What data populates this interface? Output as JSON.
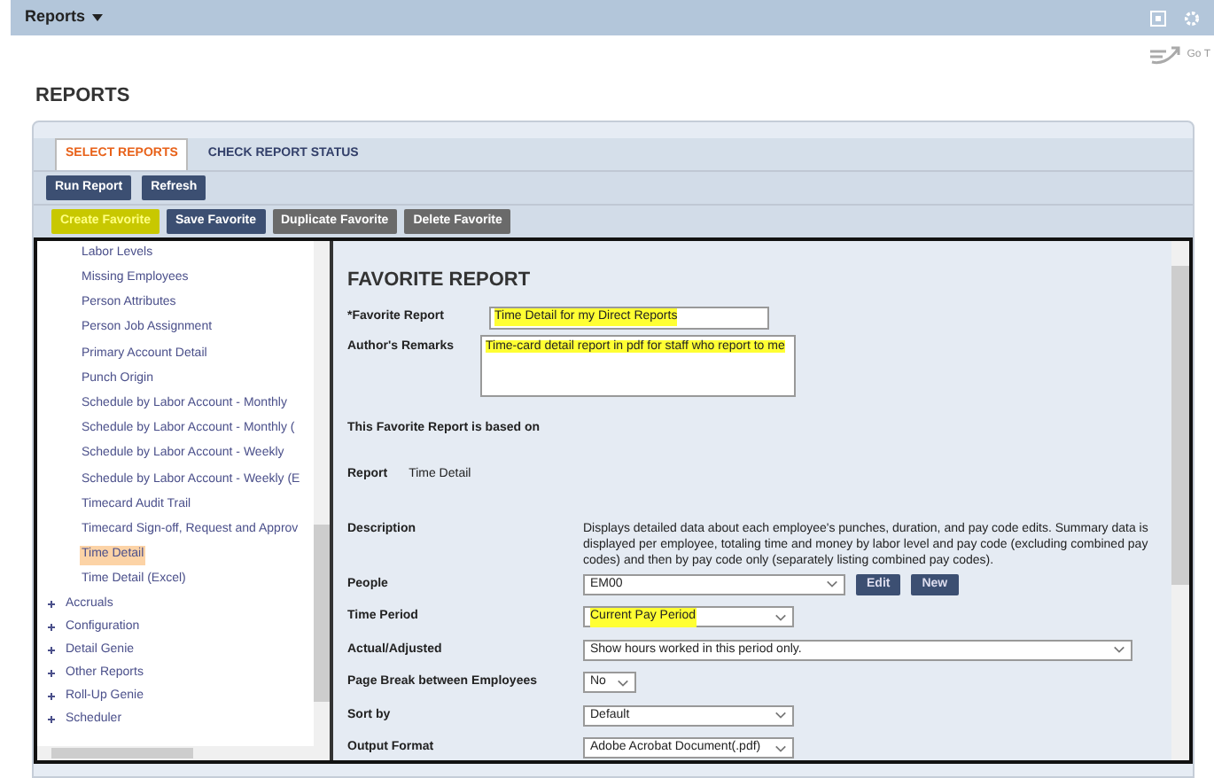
{
  "topbar": {
    "title": "Reports",
    "go_to": "Go T"
  },
  "page_title": "REPORTS",
  "tabs": [
    {
      "label": "SELECT REPORTS",
      "selected": true
    },
    {
      "label": "CHECK REPORT STATUS",
      "selected": false
    }
  ],
  "toolbar": [
    {
      "label": "Run Report",
      "highlighted": false
    },
    {
      "label": "Refresh",
      "highlighted": false
    }
  ],
  "favorite_toolbar": [
    {
      "label": "Create Favorite",
      "highlighted": true
    },
    {
      "label": "Save Favorite",
      "highlighted": false
    },
    {
      "label": "Duplicate Favorite",
      "highlighted": false
    },
    {
      "label": "Delete Favorite",
      "highlighted": false
    }
  ],
  "tree": [
    {
      "label": "Labor Levels",
      "selected": false
    },
    {
      "label": "Missing Employees",
      "selected": false
    },
    {
      "label": "Person Attributes",
      "selected": false
    },
    {
      "label": "Person Job Assignment",
      "selected": false
    },
    {
      "label": "Primary Account Detail",
      "selected": false
    },
    {
      "label": "Punch Origin",
      "selected": false
    },
    {
      "label": "Schedule by Labor Account - Monthly",
      "selected": false
    },
    {
      "label": "Schedule by Labor Account - Monthly (",
      "selected": false
    },
    {
      "label": "Schedule by Labor Account - Weekly",
      "selected": false
    },
    {
      "label": "Schedule by Labor Account - Weekly (E",
      "selected": false
    },
    {
      "label": "Timecard Audit Trail",
      "selected": false
    },
    {
      "label": "Timecard Sign-off, Request and Approv",
      "selected": false
    },
    {
      "label": "Time Detail",
      "selected": true
    },
    {
      "label": "Time Detail (Excel)",
      "selected": false
    }
  ],
  "tree_groups": [
    {
      "label": "Accruals",
      "expanded": false
    },
    {
      "label": "Configuration",
      "expanded": false
    },
    {
      "label": "Detail Genie",
      "expanded": false
    },
    {
      "label": "Other Reports",
      "expanded": false
    },
    {
      "label": "Roll-Up Genie",
      "expanded": false
    },
    {
      "label": "Scheduler",
      "expanded": false
    }
  ],
  "form": {
    "title": "FAVORITE REPORT",
    "favorite_report": {
      "label": "*Favorite Report",
      "value": "Time Detail for my Direct Reports",
      "highlighted": true
    },
    "remarks": {
      "label": "Author's Remarks",
      "value": "Time-card detail report in pdf for staff who report to me",
      "highlighted": true
    },
    "based_on": "This Favorite Report is based on",
    "report": {
      "label": "Report",
      "value": "Time Detail"
    },
    "description": {
      "label": "Description",
      "value": "Displays detailed data about each employee's punches, duration, and pay code edits. Summary data is displayed per employee, totaling time and money by labor level and pay code (excluding combined pay codes) and then by pay code only (separately listing combined pay codes)."
    },
    "selects": [
      {
        "kind": "people",
        "label": "People",
        "value": "EM00",
        "highlighted": false,
        "buttons": [
          "Edit",
          "New"
        ]
      },
      {
        "kind": "select",
        "label": "Time Period",
        "value": "Current Pay Period",
        "highlighted": true
      },
      {
        "kind": "wide",
        "label": "Actual/Adjusted",
        "value": "Show hours worked in this period only.",
        "highlighted": false
      },
      {
        "kind": "small",
        "label": "Page Break between Employees",
        "value": "No",
        "highlighted": false
      },
      {
        "kind": "select",
        "label": "Sort by",
        "value": "Default",
        "highlighted": false
      },
      {
        "kind": "select",
        "label": "Output Format",
        "value": "Adobe Acrobat Document(.pdf)",
        "highlighted": false
      }
    ]
  }
}
